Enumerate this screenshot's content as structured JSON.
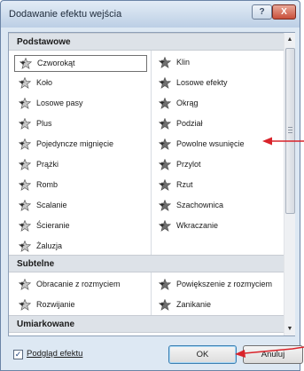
{
  "dialog": {
    "title": "Dodawanie efektu wejścia",
    "help_label": "?",
    "close_label": "X"
  },
  "sections": {
    "basic": "Podstawowe",
    "subtle": "Subtelne",
    "moderate": "Umiarkowane"
  },
  "basic_items": [
    {
      "label": "Czworokąt",
      "icon": "star-effect-icon"
    },
    {
      "label": "Klin",
      "icon": "star-effect-icon"
    },
    {
      "label": "Koło",
      "icon": "star-effect-icon"
    },
    {
      "label": "Losowe efekty",
      "icon": "star-effect-icon"
    },
    {
      "label": "Losowe pasy",
      "icon": "star-effect-icon"
    },
    {
      "label": "Okrąg",
      "icon": "star-effect-icon"
    },
    {
      "label": "Plus",
      "icon": "star-effect-icon"
    },
    {
      "label": "Podział",
      "icon": "star-effect-icon"
    },
    {
      "label": "Pojedyncze mignięcie",
      "icon": "star-effect-icon"
    },
    {
      "label": "Powolne wsunięcie",
      "icon": "star-effect-icon"
    },
    {
      "label": "Prążki",
      "icon": "star-effect-icon"
    },
    {
      "label": "Przylot",
      "icon": "star-effect-icon"
    },
    {
      "label": "Romb",
      "icon": "star-effect-icon"
    },
    {
      "label": "Rzut",
      "icon": "star-effect-icon"
    },
    {
      "label": "Scalanie",
      "icon": "star-effect-icon"
    },
    {
      "label": "Szachownica",
      "icon": "star-effect-icon"
    },
    {
      "label": "Ścieranie",
      "icon": "star-effect-icon"
    },
    {
      "label": "Wkraczanie",
      "icon": "star-effect-icon"
    },
    {
      "label": "Żaluzja",
      "icon": "star-effect-icon"
    }
  ],
  "subtle_items": [
    {
      "label": "Obracanie z rozmyciem",
      "icon": "star-effect-icon"
    },
    {
      "label": "Powiększenie z rozmyciem",
      "icon": "star-effect-icon"
    },
    {
      "label": "Rozwijanie",
      "icon": "star-effect-icon"
    },
    {
      "label": "Zanikanie",
      "icon": "star-effect-icon"
    }
  ],
  "selected_item": "Czworokąt",
  "footer": {
    "preview_label": "Podgląd efektu",
    "preview_checked": true,
    "ok_label": "OK",
    "cancel_label": "Anuluj"
  },
  "colors": {
    "annotation_arrow": "#d9232a",
    "section_header_bg": "#dde2e8"
  }
}
